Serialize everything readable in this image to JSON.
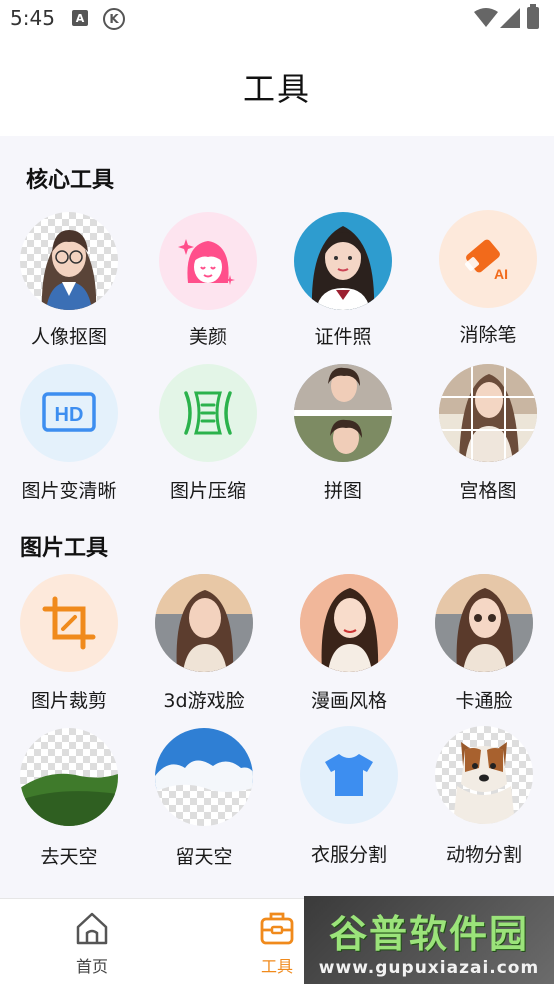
{
  "status_bar": {
    "time": "5:45",
    "a_icon": "A",
    "k_icon": "K"
  },
  "header": {
    "title": "工具"
  },
  "sections": [
    {
      "title": "核心工具",
      "tools": [
        {
          "label": "人像抠图",
          "icon": "portrait-cutout-icon"
        },
        {
          "label": "美颜",
          "icon": "beauty-face-icon"
        },
        {
          "label": "证件照",
          "icon": "id-photo-icon"
        },
        {
          "label": "消除笔",
          "icon": "ai-eraser-icon"
        },
        {
          "label": "图片变清晰",
          "icon": "hd-icon"
        },
        {
          "label": "图片压缩",
          "icon": "compress-icon"
        },
        {
          "label": "拼图",
          "icon": "collage-icon"
        },
        {
          "label": "宫格图",
          "icon": "grid-icon"
        }
      ]
    },
    {
      "title": "图片工具",
      "tools": [
        {
          "label": "图片裁剪",
          "icon": "crop-icon"
        },
        {
          "label": "3d游戏脸",
          "icon": "game-face-icon"
        },
        {
          "label": "漫画风格",
          "icon": "comic-style-icon"
        },
        {
          "label": "卡通脸",
          "icon": "cartoon-face-icon"
        },
        {
          "label": "去天空",
          "icon": "remove-sky-icon"
        },
        {
          "label": "留天空",
          "icon": "keep-sky-icon"
        },
        {
          "label": "衣服分割",
          "icon": "tshirt-icon"
        },
        {
          "label": "动物分割",
          "icon": "animal-icon"
        }
      ]
    }
  ],
  "bottom_nav": [
    {
      "label": "首页",
      "icon": "home-icon",
      "active": false
    },
    {
      "label": "工具",
      "icon": "toolbox-icon",
      "active": true
    }
  ],
  "watermark": {
    "title": "谷普软件园",
    "url": "www.gupuxiazai.com"
  },
  "colors": {
    "accent": "#f08a1c",
    "background": "#f6f6fb",
    "blue_icon": "#3d8ef0",
    "green_icon": "#2bb24c"
  }
}
